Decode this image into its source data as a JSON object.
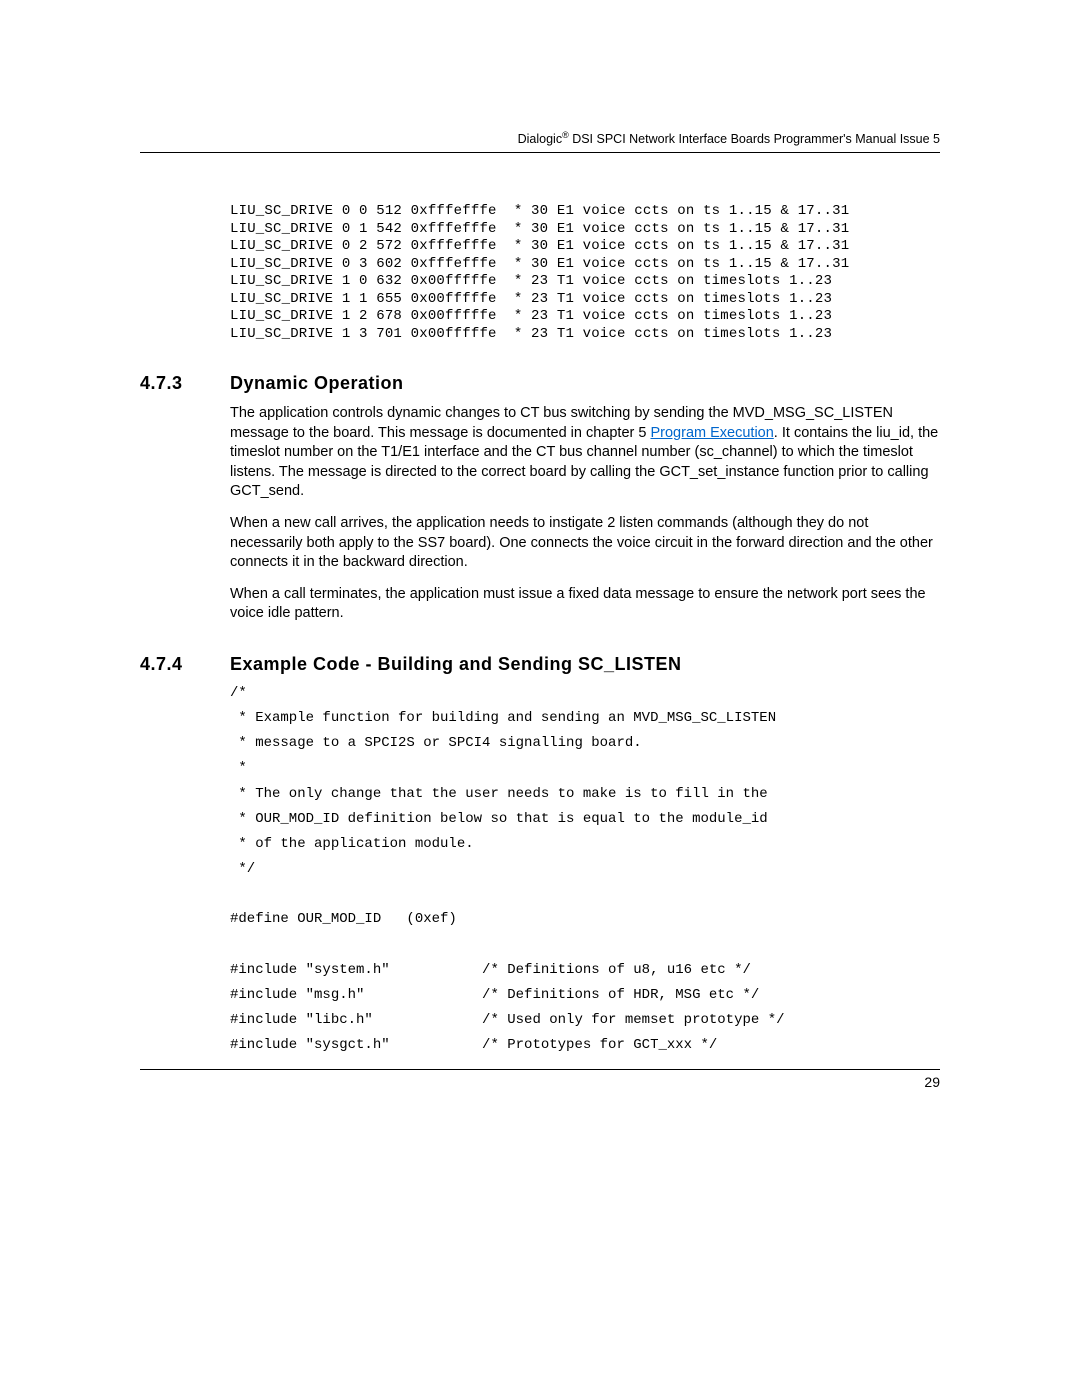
{
  "header": {
    "prefix": "Dialogic",
    "sup": "®",
    "rest": " DSI SPCI Network Interface Boards Programmer's Manual Issue 5"
  },
  "code_block_1": "LIU_SC_DRIVE 0 0 512 0xfffefffe  * 30 E1 voice ccts on ts 1..15 & 17..31\nLIU_SC_DRIVE 0 1 542 0xfffefffe  * 30 E1 voice ccts on ts 1..15 & 17..31\nLIU_SC_DRIVE 0 2 572 0xfffefffe  * 30 E1 voice ccts on ts 1..15 & 17..31\nLIU_SC_DRIVE 0 3 602 0xfffefffe  * 30 E1 voice ccts on ts 1..15 & 17..31\nLIU_SC_DRIVE 1 0 632 0x00fffffe  * 23 T1 voice ccts on timeslots 1..23\nLIU_SC_DRIVE 1 1 655 0x00fffffe  * 23 T1 voice ccts on timeslots 1..23\nLIU_SC_DRIVE 1 2 678 0x00fffffe  * 23 T1 voice ccts on timeslots 1..23\nLIU_SC_DRIVE 1 3 701 0x00fffffe  * 23 T1 voice ccts on timeslots 1..23",
  "sec473": {
    "num": "4.7.3",
    "title": "Dynamic Operation",
    "p1a": "The application controls dynamic changes to CT bus switching by sending the MVD_MSG_SC_LISTEN message to the board. This message is documented in chapter 5 ",
    "link": "Program Execution",
    "p1b": ". It contains the liu_id, the timeslot number on the T1/E1 interface and the CT bus channel number (sc_channel) to which the timeslot listens. The message is directed to the correct board by calling the GCT_set_instance function prior to calling GCT_send.",
    "p2": "When a new call arrives, the application needs to instigate 2 listen commands (although they do not necessarily both apply to the SS7 board). One connects the voice circuit in the forward direction and the other connects it in the backward direction.",
    "p3": "When a call terminates, the application must issue a fixed data message to ensure the network port sees the voice idle pattern."
  },
  "sec474": {
    "num": "4.7.4",
    "title": "Example Code - Building and Sending SC_LISTEN",
    "code": "/*\n * Example function for building and sending an MVD_MSG_SC_LISTEN\n * message to a SPCI2S or SPCI4 signalling board.\n *\n * The only change that the user needs to make is to fill in the\n * OUR_MOD_ID definition below so that is equal to the module_id\n * of the application module.\n */\n\n#define OUR_MOD_ID   (0xef)\n\n#include \"system.h\"           /* Definitions of u8, u16 etc */\n#include \"msg.h\"              /* Definitions of HDR, MSG etc */\n#include \"libc.h\"             /* Used only for memset prototype */\n#include \"sysgct.h\"           /* Prototypes for GCT_xxx */"
  },
  "pagenum": "29"
}
